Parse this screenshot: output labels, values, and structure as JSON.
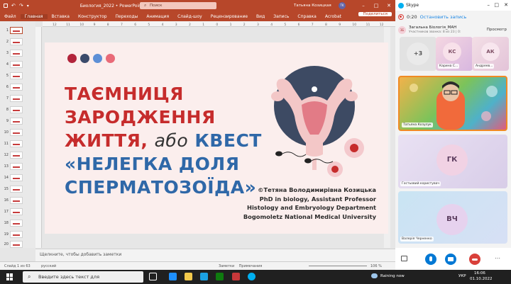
{
  "powerpoint": {
    "title": {
      "autosave_icon": "save-icon",
      "doc_name": "Биология_2022 • PowerPoint",
      "search_placeholder": "Поиск",
      "user_name": "Татьяна Козицкая",
      "user_initials": "TK"
    },
    "ribbon": {
      "tabs": [
        "Файл",
        "Главная",
        "Вставка",
        "Конструктор",
        "Переходы",
        "Анимация",
        "Слайд-шоу",
        "Рецензирование",
        "Вид",
        "Запись",
        "Справка",
        "Acrobat"
      ],
      "share_label": "Поделиться"
    },
    "ruler_marks": [
      "12",
      "11",
      "10",
      "9",
      "8",
      "7",
      "6",
      "5",
      "4",
      "3",
      "2",
      "1",
      "0",
      "1",
      "2",
      "3",
      "4",
      "5",
      "6",
      "7",
      "8",
      "9",
      "10",
      "11",
      "12"
    ],
    "thumbnails": [
      "1",
      "2",
      "3",
      "4",
      "5",
      "6",
      "7",
      "8",
      "9",
      "10",
      "11",
      "12",
      "13",
      "14",
      "15",
      "16",
      "17",
      "18",
      "19",
      "20"
    ],
    "slide": {
      "colors": {
        "dot1": "#b2243b",
        "dot2": "#3b4a6b",
        "dot3": "#5d8fd6",
        "dot4": "#e96a78"
      },
      "title_line1": "ТАЄМНИЦЯ",
      "title_line2": "ЗАРОДЖЕННЯ",
      "title_line3_a": "ЖИТТЯ,",
      "title_line3_b": "або",
      "title_line3_c": "КВЕСТ",
      "title_line4": "«НЕЛЕГКА ДОЛЯ",
      "title_line5": "СПЕРМАТОЗОЇДА»",
      "author_line1": "©Тетяна Володимирівна Козицька",
      "author_line2": "PhD in biology, Assistant Professor",
      "author_line3": "Histology and Embryology Department",
      "author_line4": "Bogomoletz National Medical University"
    },
    "notes_placeholder": "Щелкните, чтобы добавить заметки",
    "status": {
      "slide_counter": "Слайд 1 из 63",
      "language": "русский",
      "notes_btn": "Заметки",
      "comments_btn": "Примечания",
      "zoom": "106 %"
    }
  },
  "skype": {
    "app_name": "Skype",
    "recording_time": "0:20",
    "stop_recording": "Остановить запись",
    "group_initials": "ЗБ",
    "group_name": "Загальна Біологія_МАН",
    "group_sub": "Участников звонка: 8 из 23 | 0:",
    "preview_label": "Просмотр",
    "tiles": [
      {
        "initials": "+3",
        "label": ""
      },
      {
        "initials": "КС",
        "label": "Карина С..."
      },
      {
        "initials": "АК",
        "label": "Андреев..."
      },
      {
        "initials": "",
        "label": "Татьяна Козулук"
      },
      {
        "initials": "ГК",
        "label": "Гостьовий користувач"
      },
      {
        "initials": "ВЧ",
        "label": "Валерія Черненко"
      }
    ]
  },
  "taskbar": {
    "search_placeholder": "Введите здесь текст для",
    "weather": "Raining now",
    "lang": "УКР",
    "time": "16:06",
    "date": "01.10.2022"
  }
}
